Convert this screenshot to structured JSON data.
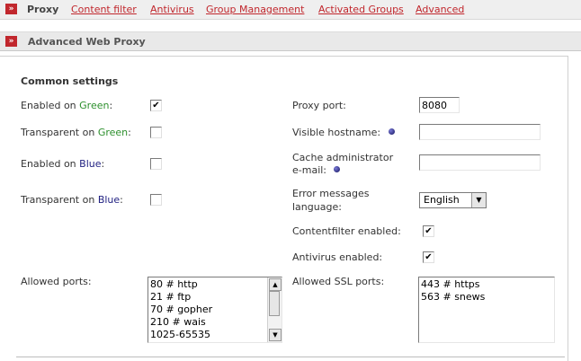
{
  "nav": {
    "tabs": [
      {
        "label": "Proxy",
        "active": true
      },
      {
        "label": "Content filter"
      },
      {
        "label": "Antivirus"
      },
      {
        "label": "Group Management"
      },
      {
        "label": "Activated Groups"
      },
      {
        "label": "Advanced"
      }
    ]
  },
  "section": {
    "icon_glyph": "»",
    "title": "Advanced Web Proxy"
  },
  "common": {
    "heading": "Common settings"
  },
  "left": {
    "enabled_green": {
      "prefix": "Enabled on ",
      "net": "Green",
      "suffix": ":",
      "checked": "✔"
    },
    "transparent_green": {
      "prefix": "Transparent on ",
      "net": "Green",
      "suffix": ":"
    },
    "enabled_blue": {
      "prefix": "Enabled on ",
      "net": "Blue",
      "suffix": ":"
    },
    "transparent_blue": {
      "prefix": "Transparent on ",
      "net": "Blue",
      "suffix": ":"
    },
    "allowed_ports": {
      "label": "Allowed ports:",
      "lines": [
        "80 # http",
        "21 # ftp",
        "70 # gopher",
        "210 # wais",
        "1025-65535"
      ]
    }
  },
  "right": {
    "proxy_port": {
      "label": "Proxy port:",
      "value": "8080"
    },
    "visible_hostname": {
      "label": "Visible hostname:",
      "value": ""
    },
    "cache_admin": {
      "label_line1": "Cache administrator",
      "label_line2": "e-mail:",
      "value": ""
    },
    "error_lang": {
      "label_line1": "Error messages",
      "label_line2": "language:",
      "value": "English"
    },
    "contentfilter": {
      "label": "Contentfilter enabled:",
      "checked": "✔"
    },
    "antivirus": {
      "label": "Antivirus enabled:",
      "checked": "✔"
    },
    "allowed_ssl_ports": {
      "label": "Allowed SSL ports:",
      "lines": [
        "443 # https",
        "563 # snews"
      ]
    }
  },
  "colors": {
    "accent": "#c1272d",
    "green": "#2c8f2c",
    "blue": "#1f1f80"
  },
  "icons": {
    "up_arrow": "▲",
    "down_arrow": "▼",
    "select_arrow": "▼"
  }
}
